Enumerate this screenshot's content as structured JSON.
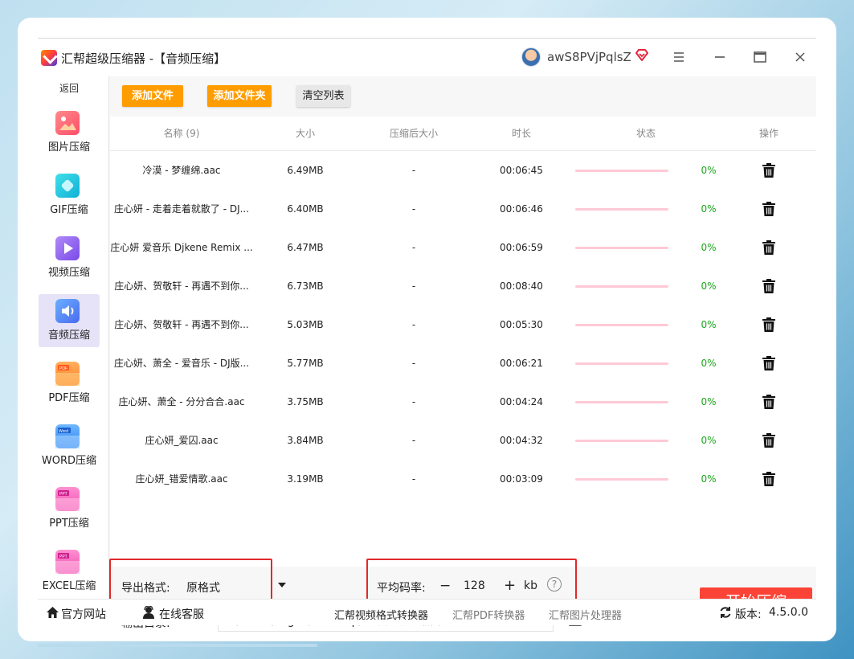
{
  "app": {
    "title": "汇帮超级压缩器   -【音频压缩】",
    "username": "awS8PVjPqlsZ"
  },
  "sidebar": {
    "back_label": "返回",
    "items": [
      {
        "label": "图片压缩",
        "icon": "image-icon",
        "color": "#ff6a6a"
      },
      {
        "label": "GIF压缩",
        "icon": "gif-icon",
        "color": "#1fc8e0"
      },
      {
        "label": "视频压缩",
        "icon": "video-icon",
        "color": "#8a5cf0"
      },
      {
        "label": "音频压缩",
        "icon": "audio-icon",
        "color": "#5a7cf0"
      },
      {
        "label": "PDF压缩",
        "icon": "pdf-icon",
        "color": "#ff8a2a"
      },
      {
        "label": "WORD压缩",
        "icon": "word-icon",
        "color": "#2a8af0"
      },
      {
        "label": "PPT压缩",
        "icon": "ppt-icon",
        "color": "#f05ab0"
      },
      {
        "label": "EXCEL压缩",
        "icon": "excel-icon",
        "color": "#f05ab0"
      }
    ]
  },
  "toolbar": {
    "add_file": "添加文件",
    "add_folder": "添加文件夹",
    "clear_list": "清空列表"
  },
  "table": {
    "headers": {
      "name": "名称 (9)",
      "size": "大小",
      "compressed_size": "压缩后大小",
      "duration": "时长",
      "status": "状态",
      "action": "操作"
    },
    "rows": [
      {
        "name": "冷漠 - 梦缠绵.aac",
        "size": "6.49MB",
        "compressed": "-",
        "duration": "00:06:45",
        "progress": 0,
        "pct": "0%"
      },
      {
        "name": "庄心妍 - 走着走着就散了 - DJ...",
        "size": "6.40MB",
        "compressed": "-",
        "duration": "00:06:46",
        "progress": 0,
        "pct": "0%"
      },
      {
        "name": "庄心妍 爱音乐 Djkene Remix ...",
        "size": "6.47MB",
        "compressed": "-",
        "duration": "00:06:59",
        "progress": 0,
        "pct": "0%"
      },
      {
        "name": "庄心妍、贺敬轩 - 再遇不到你...",
        "size": "6.73MB",
        "compressed": "-",
        "duration": "00:08:40",
        "progress": 0,
        "pct": "0%"
      },
      {
        "name": "庄心妍、贺敬轩 - 再遇不到你...",
        "size": "5.03MB",
        "compressed": "-",
        "duration": "00:05:30",
        "progress": 0,
        "pct": "0%"
      },
      {
        "name": "庄心妍、萧全 - 爱音乐 - DJ版...",
        "size": "5.77MB",
        "compressed": "-",
        "duration": "00:06:21",
        "progress": 0,
        "pct": "0%"
      },
      {
        "name": "庄心妍、萧全 - 分分合合.aac",
        "size": "3.75MB",
        "compressed": "-",
        "duration": "00:04:24",
        "progress": 0,
        "pct": "0%"
      },
      {
        "name": "庄心妍_爱囚.aac",
        "size": "3.84MB",
        "compressed": "-",
        "duration": "00:04:32",
        "progress": 0,
        "pct": "0%"
      },
      {
        "name": "庄心妍_错爱情歌.aac",
        "size": "3.19MB",
        "compressed": "-",
        "duration": "00:03:09",
        "progress": 0,
        "pct": "0%"
      }
    ]
  },
  "settings": {
    "format_label": "导出格式:",
    "format_value": "原格式",
    "bitrate_label": "平均码率:",
    "bitrate_minus": "−",
    "bitrate_value": "128",
    "bitrate_plus": "+",
    "bitrate_unit": "kb",
    "help": "?",
    "output_label": "输出目录:",
    "output_path": "C:/Users/ruguo/Desktop/汇帮超级压缩器",
    "start_button": "开始压缩"
  },
  "footer": {
    "website": "官方网站",
    "support": "在线客服",
    "link1": "汇帮视频格式转换器",
    "link2": "汇帮PDF转换器",
    "link3": "汇帮图片处理器",
    "version_label": "版本:",
    "version": "4.5.0.0"
  },
  "colors": {
    "accent_orange": "#ff9d00",
    "start_red": "#fb4437",
    "highlight_red": "#e02a2a",
    "progress_pink": "#ffc9d6",
    "success_green": "#1aa51a"
  }
}
